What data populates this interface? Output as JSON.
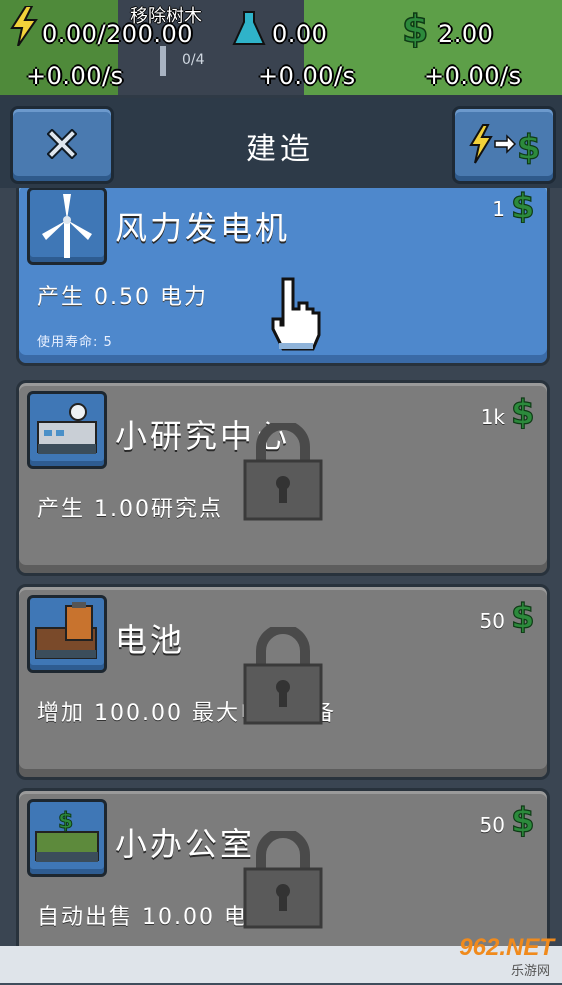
{
  "hud": {
    "energy_value": "0.00/200.00",
    "energy_rate": "+0.00/s",
    "research_value": "0.00",
    "research_rate": "+0.00/s",
    "money_value": "2.00",
    "money_rate": "+0.00/s",
    "remove_trees_label": "移除树木",
    "remove_trees_count": "0/4"
  },
  "panel": {
    "title": "建造",
    "close_icon": "close-icon",
    "convert_icon": "energy-to-money-icon"
  },
  "buildings": [
    {
      "name": "风力发电机",
      "cost": "1",
      "desc": "产生 0.50 电力",
      "sub": "使用寿命: 5",
      "locked": false,
      "icon": "wind-turbine-icon"
    },
    {
      "name": "小研究中心",
      "cost": "1k",
      "desc": "产生 1.00研究点",
      "locked": true,
      "icon": "research-center-icon"
    },
    {
      "name": "电池",
      "cost": "50",
      "desc": "增加 100.00 最大电量储备",
      "locked": true,
      "icon": "battery-icon"
    },
    {
      "name": "小办公室",
      "cost": "50",
      "desc": "自动出售 10.00 电力",
      "locked": true,
      "icon": "office-icon"
    }
  ],
  "watermark": {
    "line1": "962.NET",
    "line2": "乐游网"
  },
  "colors": {
    "card_active": "#4e88cc",
    "card_locked": "#7c7c7c",
    "money_green": "#2c8a3c",
    "energy_yellow": "#f2d23a"
  }
}
